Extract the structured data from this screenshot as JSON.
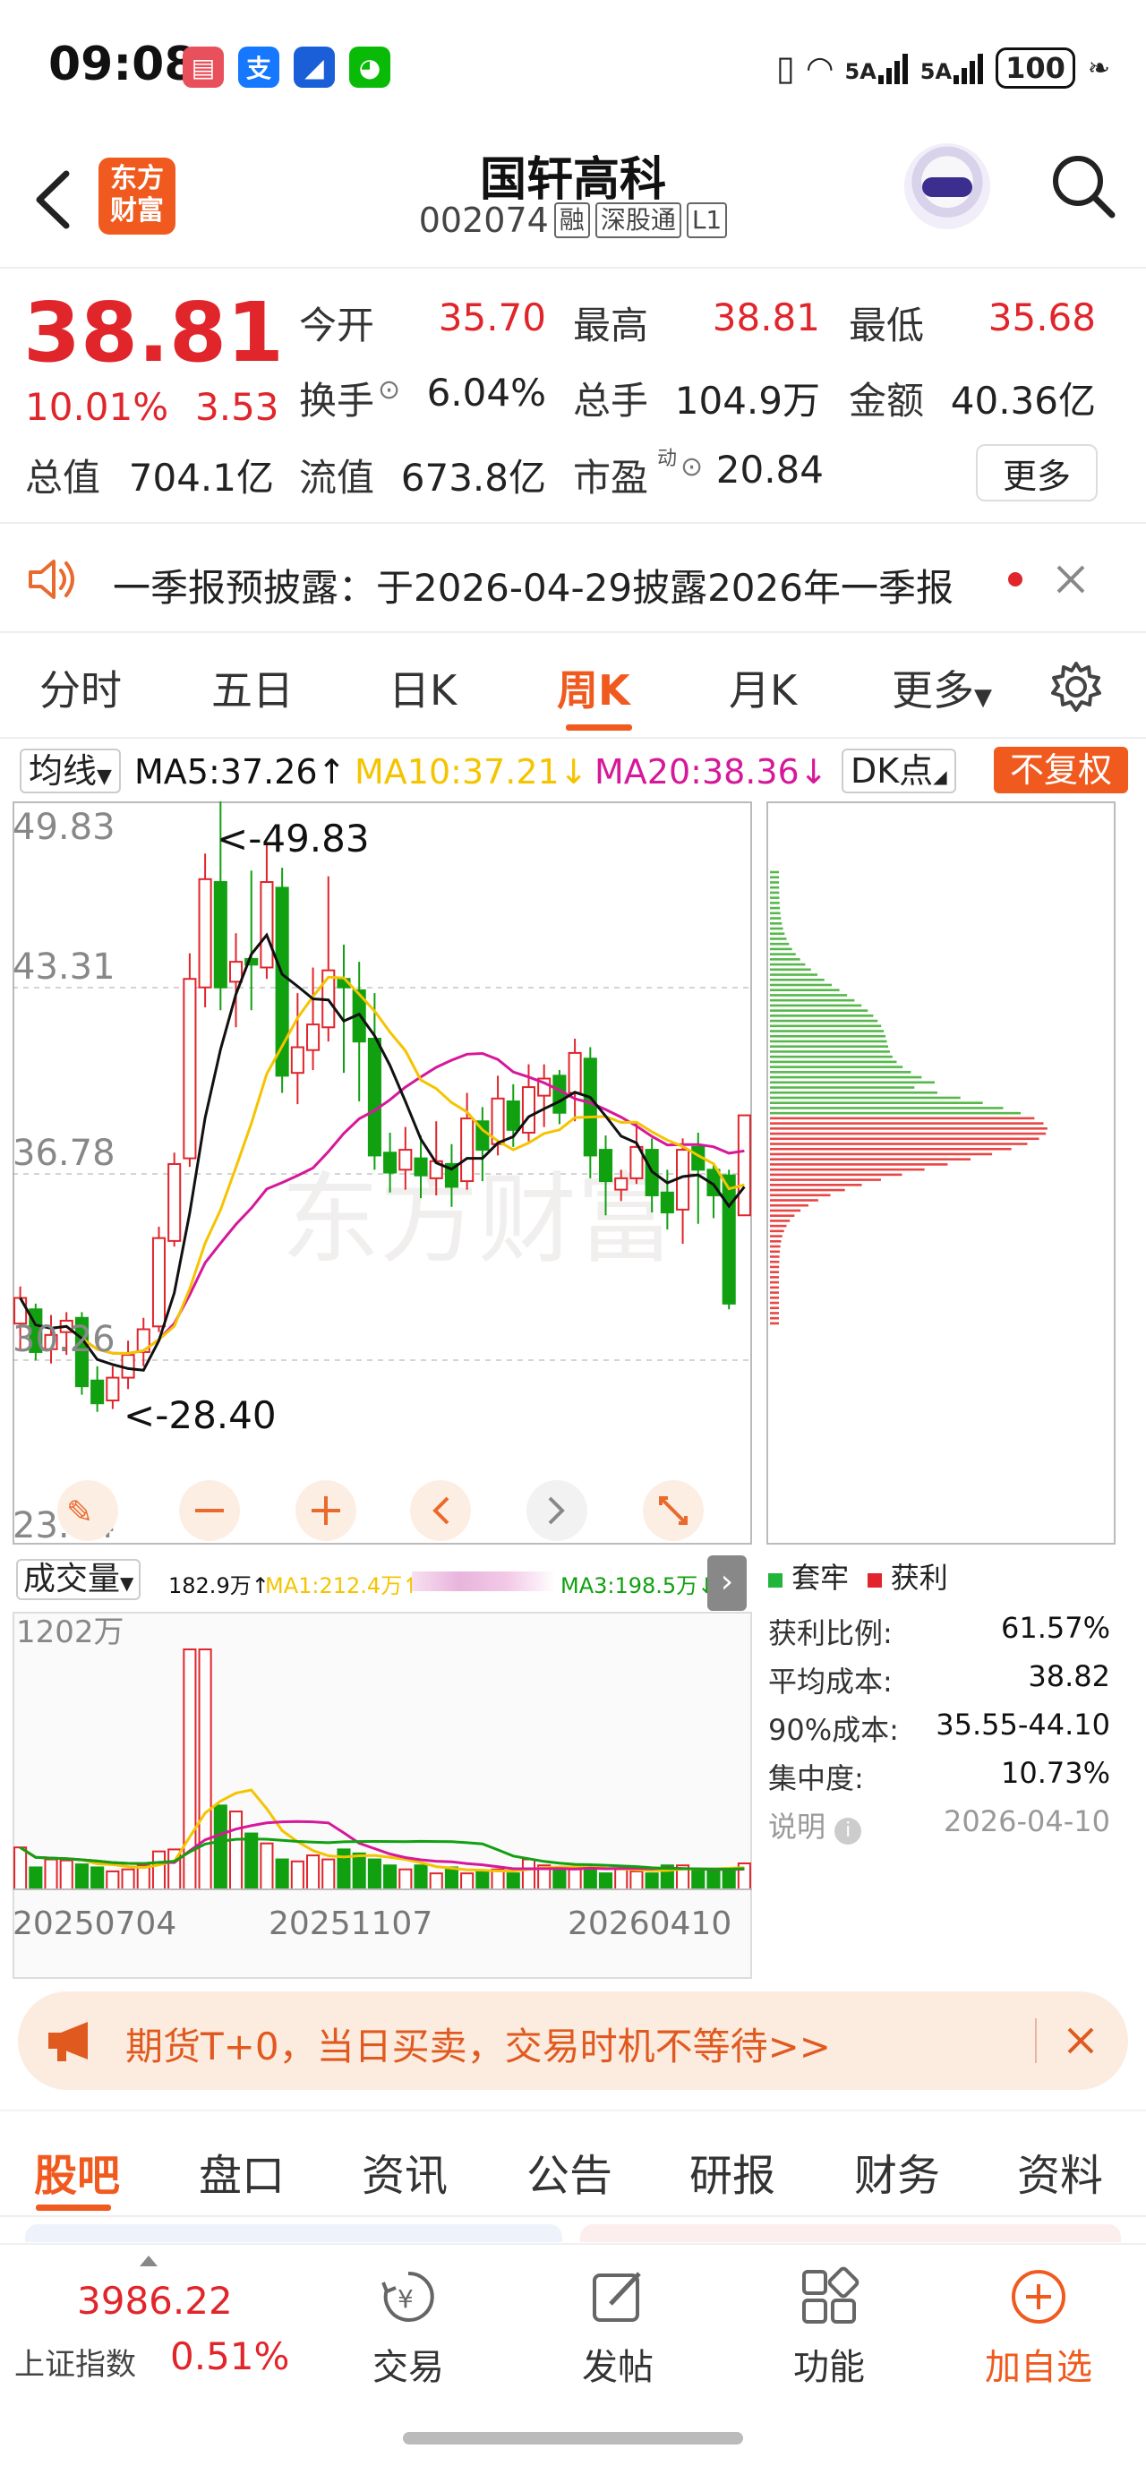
{
  "status_bar": {
    "time": "09:08",
    "net1": "5A",
    "net2": "5A",
    "battery": "100"
  },
  "header": {
    "brand_line1": "东方",
    "brand_line2": "财富",
    "stock_name": "国轩高科",
    "stock_code": "002074",
    "tags": [
      "融",
      "深股通",
      "L1"
    ]
  },
  "quote": {
    "price": "38.81",
    "change_pct": "10.01%",
    "change": "3.53",
    "stats": [
      {
        "label": "今开",
        "value": "35.70",
        "color": "red"
      },
      {
        "label": "最高",
        "value": "38.81",
        "color": "red"
      },
      {
        "label": "最低",
        "value": "35.68",
        "color": "red"
      },
      {
        "label": "换手",
        "value": "6.04%",
        "color": "black"
      },
      {
        "label": "总手",
        "value": "104.9万",
        "color": "black"
      },
      {
        "label": "金额",
        "value": "40.36亿",
        "color": "black"
      },
      {
        "label": "总值",
        "value": "704.1亿",
        "color": "black"
      },
      {
        "label": "流值",
        "value": "673.8亿",
        "color": "black"
      },
      {
        "label": "市盈",
        "value": "20.84",
        "color": "black"
      }
    ],
    "pe_superscript": "动",
    "more_label": "更多"
  },
  "notice": {
    "text": "一季报预披露：于2026-04-29披露2026年一季报"
  },
  "period_tabs": [
    "分时",
    "五日",
    "日K",
    "周K",
    "月K",
    "更多"
  ],
  "active_period": "周K",
  "ma_legend": {
    "select_label": "均线",
    "ma5": "MA5:37.26↑",
    "ma10": "MA10:37.21↓",
    "ma20": "MA20:38.36↓",
    "dk_label": "DK点",
    "fuquan_label": "不复权",
    "colors": {
      "ma5": "#111111",
      "ma10": "#f5c400",
      "ma20": "#d6189a",
      "up": "#e0252b",
      "down": "#10a010"
    }
  },
  "kline": {
    "y_labels": [
      "49.83",
      "43.31",
      "36.78",
      "30.26",
      "23.74"
    ],
    "high_annotation": "<-49.83",
    "low_annotation": "<-28.40",
    "watermark": "东方财富"
  },
  "volume": {
    "select_label": "成交量",
    "vol": "182.9万↑",
    "ma1": "MA1:212.4万↑",
    "ma3": "MA3:198.5万↓",
    "max_label": "1202万",
    "dates": [
      "20250704",
      "20251107",
      "20260410"
    ]
  },
  "chip": {
    "legend_trapped": "套牢",
    "legend_profit": "获利",
    "rows": [
      {
        "label": "获利比例:",
        "value": "61.57%"
      },
      {
        "label": "平均成本:",
        "value": "38.82"
      },
      {
        "label": "90%成本:",
        "value": "35.55-44.10"
      },
      {
        "label": "集中度:",
        "value": "10.73%"
      }
    ],
    "note_label": "说明",
    "note_date": "2026-04-10"
  },
  "ad": {
    "text": "期货T+0，当日买卖，交易时机不等待>>"
  },
  "bottom_tabs": [
    "股吧",
    "盘口",
    "资讯",
    "公告",
    "研报",
    "财务",
    "资料"
  ],
  "footer": {
    "index_value": "3986.22",
    "index_name": "上证指数",
    "index_pct": "0.51%",
    "items": [
      {
        "label": "交易",
        "icon": "trade-icon"
      },
      {
        "label": "发帖",
        "icon": "post-icon"
      },
      {
        "label": "功能",
        "icon": "function-icon"
      },
      {
        "label": "加自选",
        "icon": "add-watch-icon"
      }
    ]
  },
  "chart_data": {
    "type": "candlestick",
    "period": "weekly",
    "y_range": [
      23.74,
      49.83
    ],
    "y_ticks": [
      49.83,
      43.31,
      36.78,
      30.26,
      23.74
    ],
    "candles": [
      [
        31.5,
        32.4,
        30.6,
        32.8
      ],
      [
        32.0,
        30.5,
        30.2,
        32.2
      ],
      [
        30.6,
        31.1,
        30.1,
        31.8
      ],
      [
        31.2,
        31.6,
        30.4,
        31.9
      ],
      [
        31.7,
        29.3,
        29.0,
        31.9
      ],
      [
        29.5,
        28.7,
        28.4,
        30.0
      ],
      [
        28.8,
        29.6,
        28.5,
        30.0
      ],
      [
        29.6,
        30.4,
        29.2,
        30.9
      ],
      [
        30.5,
        31.3,
        30.0,
        31.7
      ],
      [
        31.4,
        34.5,
        31.2,
        34.9
      ],
      [
        34.4,
        37.1,
        34.2,
        37.5
      ],
      [
        37.3,
        43.6,
        37.0,
        44.5
      ],
      [
        43.3,
        47.1,
        42.6,
        48.0
      ],
      [
        47.0,
        43.3,
        42.5,
        49.83
      ],
      [
        43.5,
        44.2,
        41.9,
        45.2
      ],
      [
        44.3,
        44.1,
        42.5,
        47.4
      ],
      [
        44.0,
        47.0,
        43.6,
        48.4
      ],
      [
        46.8,
        40.2,
        39.6,
        47.5
      ],
      [
        40.3,
        41.2,
        39.2,
        43.1
      ],
      [
        41.1,
        42.0,
        40.4,
        44.0
      ],
      [
        41.9,
        43.9,
        41.4,
        47.2
      ],
      [
        43.6,
        43.3,
        40.3,
        44.8
      ],
      [
        43.2,
        41.4,
        39.3,
        44.2
      ],
      [
        41.5,
        37.4,
        36.9,
        43.1
      ],
      [
        37.5,
        36.8,
        36.1,
        38.2
      ],
      [
        36.9,
        37.6,
        36.2,
        38.4
      ],
      [
        37.3,
        36.7,
        35.9,
        38.1
      ],
      [
        36.6,
        37.2,
        36.0,
        38.6
      ],
      [
        37.1,
        36.3,
        35.6,
        37.8
      ],
      [
        36.5,
        38.7,
        36.2,
        39.6
      ],
      [
        38.6,
        37.6,
        36.5,
        39.1
      ],
      [
        37.8,
        39.4,
        37.4,
        40.2
      ],
      [
        39.3,
        38.3,
        37.7,
        39.9
      ],
      [
        38.2,
        39.8,
        37.9,
        40.6
      ],
      [
        39.5,
        40.1,
        38.4,
        40.6
      ],
      [
        40.2,
        38.9,
        38.5,
        40.4
      ],
      [
        39.6,
        41.0,
        38.6,
        41.5
      ],
      [
        40.8,
        37.4,
        36.6,
        41.2
      ],
      [
        37.6,
        36.5,
        35.3,
        38.1
      ],
      [
        36.2,
        36.6,
        35.8,
        36.9
      ],
      [
        36.6,
        37.7,
        36.4,
        38.6
      ],
      [
        37.6,
        36.0,
        35.4,
        38.0
      ],
      [
        36.1,
        35.4,
        34.8,
        36.9
      ],
      [
        35.5,
        37.6,
        34.3,
        38.0
      ],
      [
        37.7,
        36.9,
        35.0,
        38.2
      ],
      [
        36.9,
        36.0,
        35.2,
        37.1
      ],
      [
        36.7,
        32.2,
        32.0,
        36.9
      ],
      [
        35.3,
        38.81,
        35.3,
        38.81
      ]
    ],
    "volume_max": 1202,
    "volumes": [
      210,
      110,
      150,
      145,
      125,
      110,
      90,
      100,
      120,
      190,
      200,
      1202,
      1202,
      420,
      390,
      280,
      230,
      150,
      140,
      170,
      150,
      200,
      180,
      150,
      120,
      100,
      120,
      80,
      110,
      80,
      90,
      100,
      80,
      150,
      120,
      110,
      100,
      120,
      80,
      100,
      90,
      80,
      120,
      120,
      100,
      90,
      100,
      130
    ]
  }
}
